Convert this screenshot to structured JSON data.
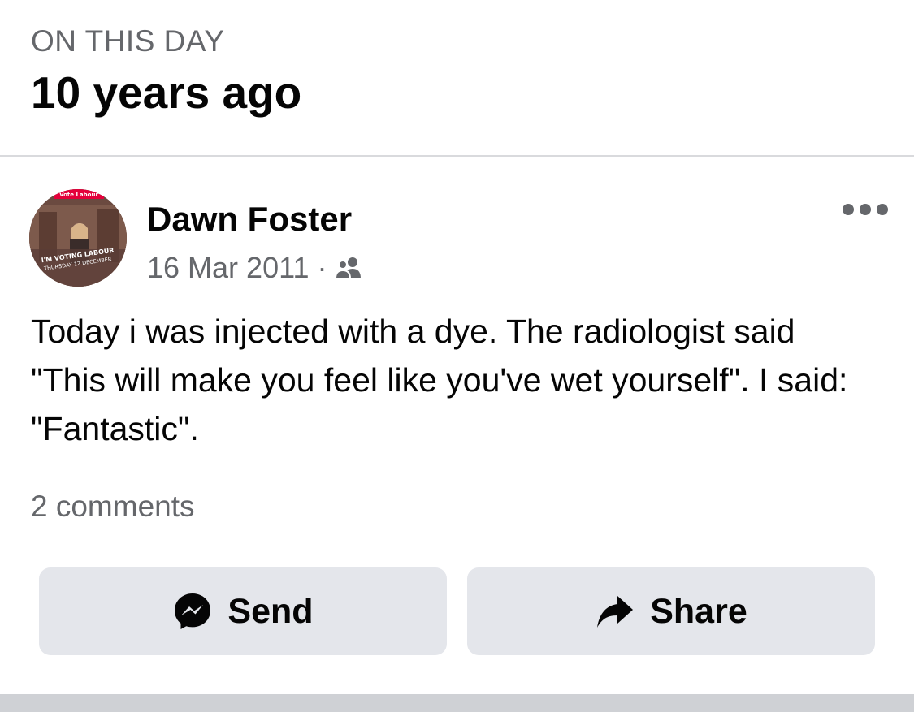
{
  "memory": {
    "eyebrow": "ON THIS DAY",
    "title": "10 years ago"
  },
  "post": {
    "author": "Dawn Foster",
    "date": "16 Mar 2011",
    "separator": "·",
    "audience_icon": "friends-icon",
    "avatar": {
      "badge_text": "Vote Labour",
      "caption_line1": "I'M VOTING LABOUR",
      "caption_line2": "THURSDAY 12 DECEMBER"
    },
    "text": "Today i was injected with a dye. The radiologist said \"This will make you feel like you've wet yourself\". I said: \"Fantastic\".",
    "comments_count": "2 comments"
  },
  "actions": {
    "send_label": "Send",
    "send_icon": "messenger-icon",
    "share_label": "Share",
    "share_icon": "share-arrow-icon",
    "more_icon": "more-options-icon"
  },
  "colors": {
    "secondary_text": "#65676b",
    "button_bg": "#e4e6eb",
    "labour_red": "#e4003b"
  }
}
